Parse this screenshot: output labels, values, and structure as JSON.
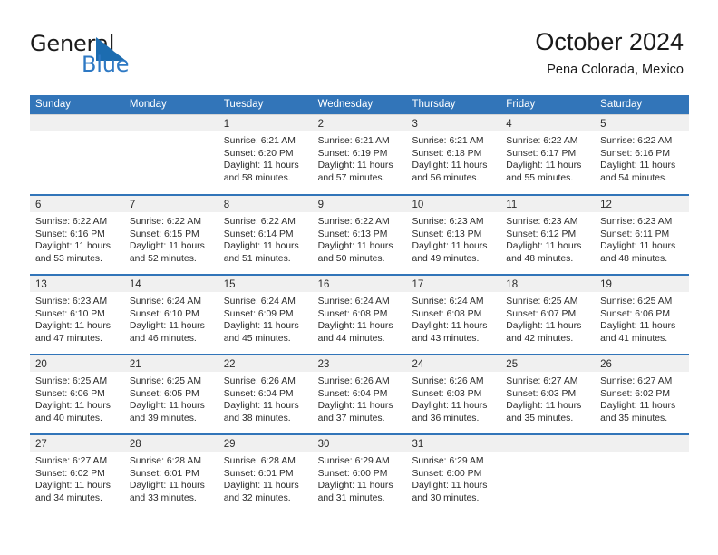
{
  "brand": {
    "word_general": "General",
    "word_blue": "Blue",
    "flag_icon": "blue-triangle-flag-icon"
  },
  "header": {
    "title": "October 2024",
    "subtitle": "Pena Colorada, Mexico"
  },
  "colors": {
    "header_blue": "#3275b9",
    "day_band_gray": "#f0f0f0",
    "brand_blue": "#2e79c4",
    "text": "#2b2b2b"
  },
  "calendar": {
    "weekday_headers": [
      "Sunday",
      "Monday",
      "Tuesday",
      "Wednesday",
      "Thursday",
      "Friday",
      "Saturday"
    ],
    "weeks": [
      [
        {
          "day": "",
          "lines": []
        },
        {
          "day": "",
          "lines": []
        },
        {
          "day": "1",
          "lines": [
            "Sunrise: 6:21 AM",
            "Sunset: 6:20 PM",
            "Daylight: 11 hours",
            "and 58 minutes."
          ]
        },
        {
          "day": "2",
          "lines": [
            "Sunrise: 6:21 AM",
            "Sunset: 6:19 PM",
            "Daylight: 11 hours",
            "and 57 minutes."
          ]
        },
        {
          "day": "3",
          "lines": [
            "Sunrise: 6:21 AM",
            "Sunset: 6:18 PM",
            "Daylight: 11 hours",
            "and 56 minutes."
          ]
        },
        {
          "day": "4",
          "lines": [
            "Sunrise: 6:22 AM",
            "Sunset: 6:17 PM",
            "Daylight: 11 hours",
            "and 55 minutes."
          ]
        },
        {
          "day": "5",
          "lines": [
            "Sunrise: 6:22 AM",
            "Sunset: 6:16 PM",
            "Daylight: 11 hours",
            "and 54 minutes."
          ]
        }
      ],
      [
        {
          "day": "6",
          "lines": [
            "Sunrise: 6:22 AM",
            "Sunset: 6:16 PM",
            "Daylight: 11 hours",
            "and 53 minutes."
          ]
        },
        {
          "day": "7",
          "lines": [
            "Sunrise: 6:22 AM",
            "Sunset: 6:15 PM",
            "Daylight: 11 hours",
            "and 52 minutes."
          ]
        },
        {
          "day": "8",
          "lines": [
            "Sunrise: 6:22 AM",
            "Sunset: 6:14 PM",
            "Daylight: 11 hours",
            "and 51 minutes."
          ]
        },
        {
          "day": "9",
          "lines": [
            "Sunrise: 6:22 AM",
            "Sunset: 6:13 PM",
            "Daylight: 11 hours",
            "and 50 minutes."
          ]
        },
        {
          "day": "10",
          "lines": [
            "Sunrise: 6:23 AM",
            "Sunset: 6:13 PM",
            "Daylight: 11 hours",
            "and 49 minutes."
          ]
        },
        {
          "day": "11",
          "lines": [
            "Sunrise: 6:23 AM",
            "Sunset: 6:12 PM",
            "Daylight: 11 hours",
            "and 48 minutes."
          ]
        },
        {
          "day": "12",
          "lines": [
            "Sunrise: 6:23 AM",
            "Sunset: 6:11 PM",
            "Daylight: 11 hours",
            "and 48 minutes."
          ]
        }
      ],
      [
        {
          "day": "13",
          "lines": [
            "Sunrise: 6:23 AM",
            "Sunset: 6:10 PM",
            "Daylight: 11 hours",
            "and 47 minutes."
          ]
        },
        {
          "day": "14",
          "lines": [
            "Sunrise: 6:24 AM",
            "Sunset: 6:10 PM",
            "Daylight: 11 hours",
            "and 46 minutes."
          ]
        },
        {
          "day": "15",
          "lines": [
            "Sunrise: 6:24 AM",
            "Sunset: 6:09 PM",
            "Daylight: 11 hours",
            "and 45 minutes."
          ]
        },
        {
          "day": "16",
          "lines": [
            "Sunrise: 6:24 AM",
            "Sunset: 6:08 PM",
            "Daylight: 11 hours",
            "and 44 minutes."
          ]
        },
        {
          "day": "17",
          "lines": [
            "Sunrise: 6:24 AM",
            "Sunset: 6:08 PM",
            "Daylight: 11 hours",
            "and 43 minutes."
          ]
        },
        {
          "day": "18",
          "lines": [
            "Sunrise: 6:25 AM",
            "Sunset: 6:07 PM",
            "Daylight: 11 hours",
            "and 42 minutes."
          ]
        },
        {
          "day": "19",
          "lines": [
            "Sunrise: 6:25 AM",
            "Sunset: 6:06 PM",
            "Daylight: 11 hours",
            "and 41 minutes."
          ]
        }
      ],
      [
        {
          "day": "20",
          "lines": [
            "Sunrise: 6:25 AM",
            "Sunset: 6:06 PM",
            "Daylight: 11 hours",
            "and 40 minutes."
          ]
        },
        {
          "day": "21",
          "lines": [
            "Sunrise: 6:25 AM",
            "Sunset: 6:05 PM",
            "Daylight: 11 hours",
            "and 39 minutes."
          ]
        },
        {
          "day": "22",
          "lines": [
            "Sunrise: 6:26 AM",
            "Sunset: 6:04 PM",
            "Daylight: 11 hours",
            "and 38 minutes."
          ]
        },
        {
          "day": "23",
          "lines": [
            "Sunrise: 6:26 AM",
            "Sunset: 6:04 PM",
            "Daylight: 11 hours",
            "and 37 minutes."
          ]
        },
        {
          "day": "24",
          "lines": [
            "Sunrise: 6:26 AM",
            "Sunset: 6:03 PM",
            "Daylight: 11 hours",
            "and 36 minutes."
          ]
        },
        {
          "day": "25",
          "lines": [
            "Sunrise: 6:27 AM",
            "Sunset: 6:03 PM",
            "Daylight: 11 hours",
            "and 35 minutes."
          ]
        },
        {
          "day": "26",
          "lines": [
            "Sunrise: 6:27 AM",
            "Sunset: 6:02 PM",
            "Daylight: 11 hours",
            "and 35 minutes."
          ]
        }
      ],
      [
        {
          "day": "27",
          "lines": [
            "Sunrise: 6:27 AM",
            "Sunset: 6:02 PM",
            "Daylight: 11 hours",
            "and 34 minutes."
          ]
        },
        {
          "day": "28",
          "lines": [
            "Sunrise: 6:28 AM",
            "Sunset: 6:01 PM",
            "Daylight: 11 hours",
            "and 33 minutes."
          ]
        },
        {
          "day": "29",
          "lines": [
            "Sunrise: 6:28 AM",
            "Sunset: 6:01 PM",
            "Daylight: 11 hours",
            "and 32 minutes."
          ]
        },
        {
          "day": "30",
          "lines": [
            "Sunrise: 6:29 AM",
            "Sunset: 6:00 PM",
            "Daylight: 11 hours",
            "and 31 minutes."
          ]
        },
        {
          "day": "31",
          "lines": [
            "Sunrise: 6:29 AM",
            "Sunset: 6:00 PM",
            "Daylight: 11 hours",
            "and 30 minutes."
          ]
        },
        {
          "day": "",
          "lines": []
        },
        {
          "day": "",
          "lines": []
        }
      ]
    ]
  }
}
